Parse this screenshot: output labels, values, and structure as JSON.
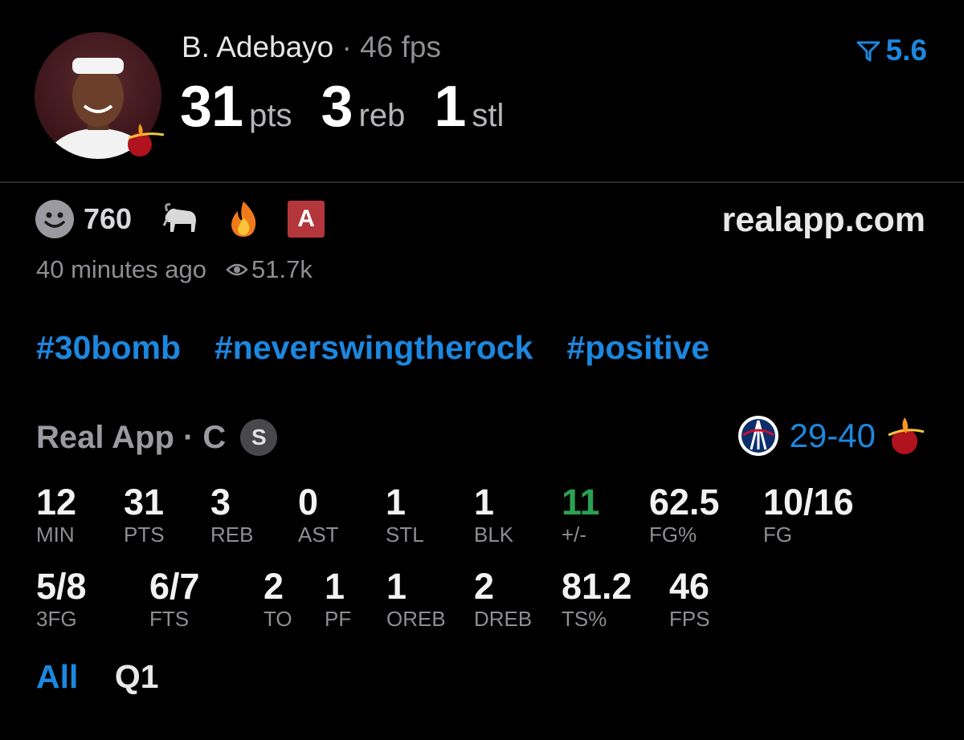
{
  "header": {
    "player": "B. Adebayo",
    "separator": "·",
    "fps_text": "46 fps",
    "stats": [
      {
        "value": "31",
        "unit": "pts"
      },
      {
        "value": "3",
        "unit": "reb"
      },
      {
        "value": "1",
        "unit": "stl"
      }
    ],
    "rating": "5.6",
    "rating_icon": "rating-funnel-icon"
  },
  "reactions": {
    "count": "760",
    "icons": [
      "smile-icon",
      "goat-icon",
      "fire-icon"
    ],
    "grade_badge": "A",
    "site": "realapp.com",
    "time_ago": "40 minutes ago",
    "views": "51.7k"
  },
  "hashtags": [
    "#30bomb",
    "#neverswingtherock",
    "#positive"
  ],
  "game": {
    "source": "Real App · C",
    "badge": "S",
    "score": "29-40",
    "colors": {
      "accent": "#1c87df",
      "positive": "#2aa152",
      "muted": "#8e8e93"
    }
  },
  "stat_rows": [
    [
      {
        "value": "12",
        "label": "MIN"
      },
      {
        "value": "31",
        "label": "PTS"
      },
      {
        "value": "3",
        "label": "REB"
      },
      {
        "value": "0",
        "label": "AST"
      },
      {
        "value": "1",
        "label": "STL"
      },
      {
        "value": "1",
        "label": "BLK"
      },
      {
        "value": "11",
        "label": "+/-"
      },
      {
        "value": "62.5",
        "label": "FG%"
      },
      {
        "value": "10/16",
        "label": "FG"
      }
    ],
    [
      {
        "value": "5/8",
        "label": "3FG"
      },
      {
        "value": "6/7",
        "label": "FTS"
      },
      {
        "value": "2",
        "label": "TO"
      },
      {
        "value": "1",
        "label": "PF"
      },
      {
        "value": "1",
        "label": "OREB"
      },
      {
        "value": "2",
        "label": "DREB"
      },
      {
        "value": "81.2",
        "label": "TS%"
      },
      {
        "value": "46",
        "label": "FPS"
      }
    ]
  ],
  "tabs": [
    {
      "label": "All",
      "active": true
    },
    {
      "label": "Q1",
      "active": false
    }
  ]
}
